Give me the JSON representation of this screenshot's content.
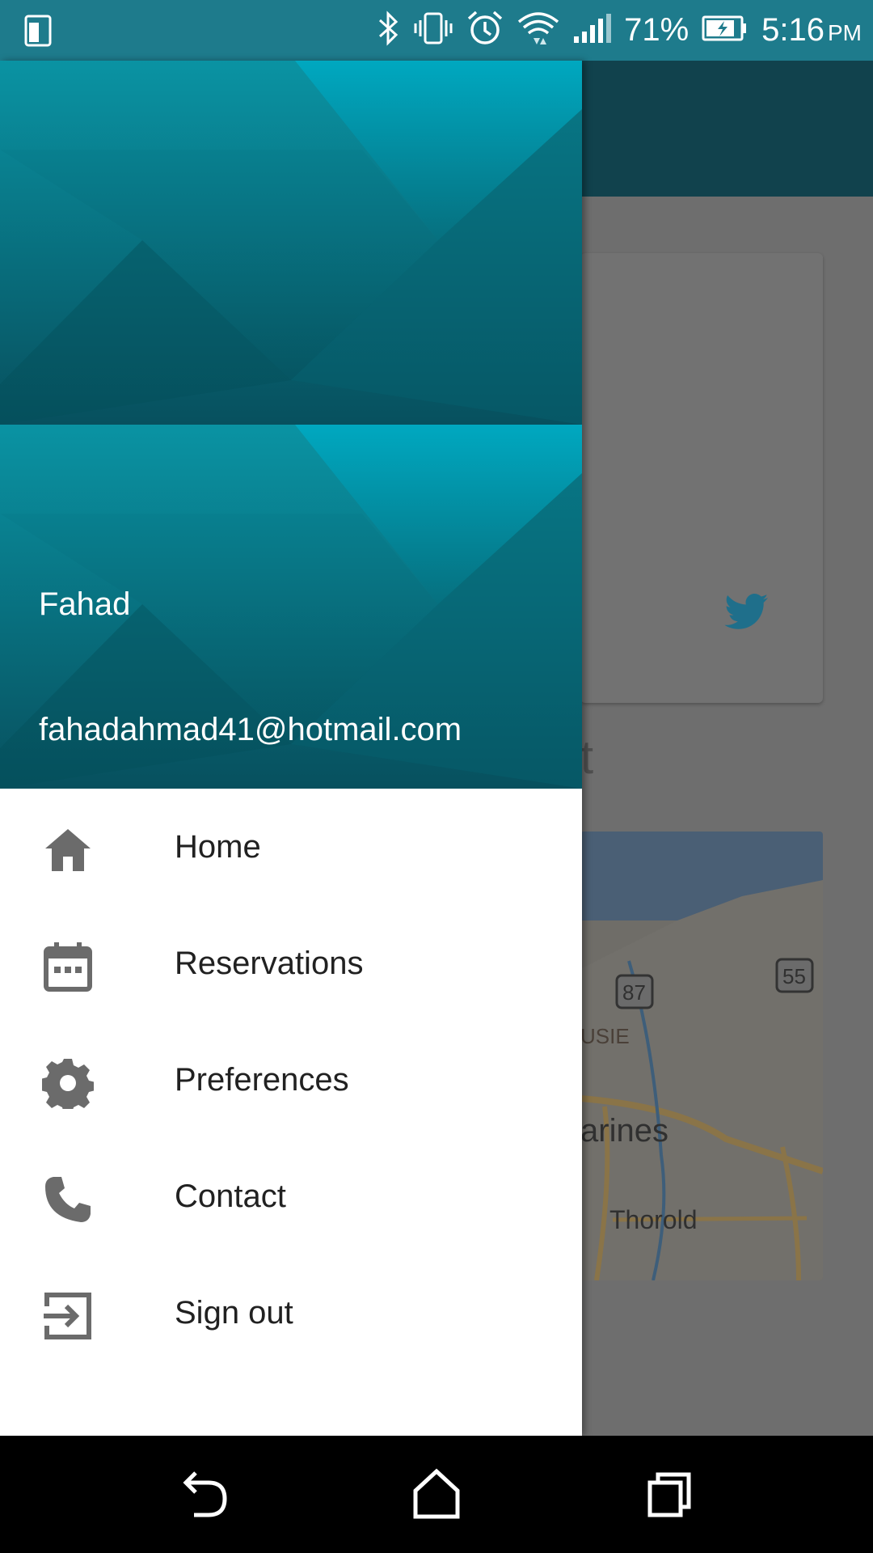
{
  "status_bar": {
    "battery_percent": "71%",
    "time": "5:16",
    "ampm": "PM",
    "icons": [
      "device-icon",
      "bluetooth-icon",
      "vibrate-icon",
      "alarm-icon",
      "wifi-icon",
      "signal-icon",
      "battery-charging-icon"
    ]
  },
  "drawer": {
    "user_name": "Fahad",
    "user_email": "fahadahmad41@hotmail.com",
    "items": [
      {
        "label": "Home",
        "icon": "home-icon"
      },
      {
        "label": "Reservations",
        "icon": "calendar-icon"
      },
      {
        "label": "Preferences",
        "icon": "gear-icon"
      },
      {
        "label": "Contact",
        "icon": "phone-icon"
      },
      {
        "label": "Sign out",
        "icon": "sign-out-icon"
      }
    ]
  },
  "background": {
    "heading_fragment": "t",
    "map_labels": {
      "route_87": "87",
      "route_55": "55",
      "area": "USIE",
      "city": "arines",
      "town": "Thorold"
    }
  },
  "colors": {
    "status_bar": "#1e7b8c",
    "header_teal": "#0a7c8c",
    "toolbar_dim": "#11424d",
    "icon_grey": "#757575",
    "nav_bar": "#000000"
  },
  "nav_bar": {
    "buttons": [
      "back-icon",
      "home-nav-icon",
      "recents-icon"
    ]
  }
}
